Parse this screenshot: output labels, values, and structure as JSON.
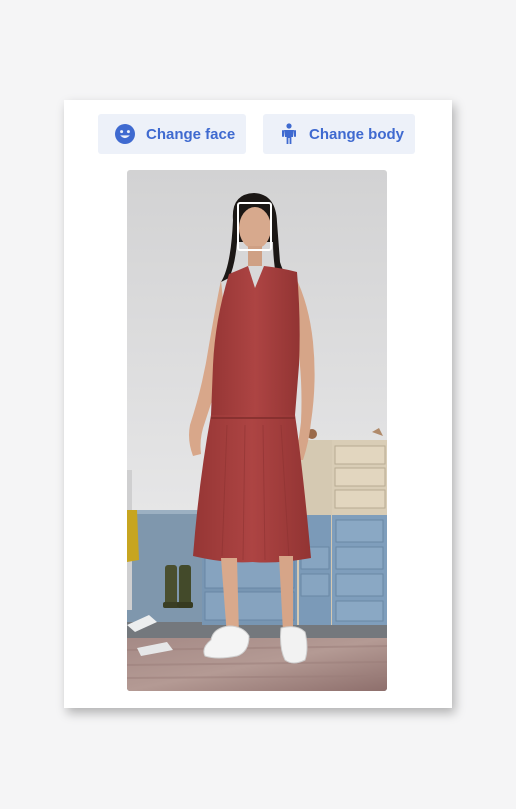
{
  "toolbar": {
    "change_face_label": "Change face",
    "change_face_icon": "smiley-face-icon",
    "change_body_label": "Change body",
    "change_body_icon": "person-figure-icon",
    "accent_color": "#3f6ad0",
    "button_bg": "#edf1f9"
  },
  "preview": {
    "image": "model-in-red-sleeveless-dress",
    "dress_color": "#a8403f",
    "face_detection_box": "face-selection-box"
  }
}
